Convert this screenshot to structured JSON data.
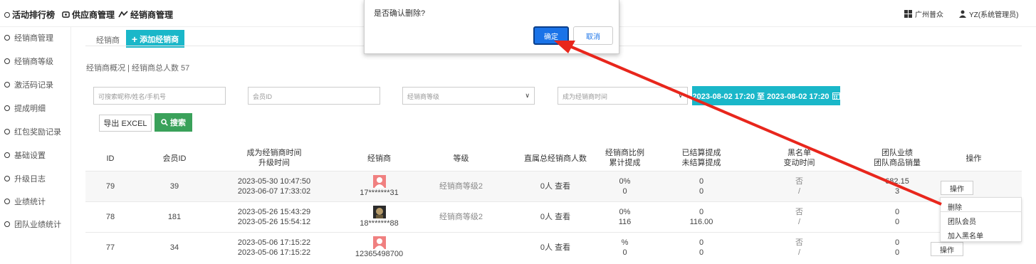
{
  "topnav": {
    "items": [
      {
        "label": "活动排行榜",
        "icon": "circle-icon"
      },
      {
        "label": "供应商管理",
        "icon": "supplier-icon"
      },
      {
        "label": "经销商管理",
        "icon": "dealer-icon"
      }
    ],
    "region": "广州普众",
    "user": "YZ(系统管理员)"
  },
  "sidebar": {
    "items": [
      {
        "label": "经销商管理"
      },
      {
        "label": "经销商等级"
      },
      {
        "label": "激活码记录"
      },
      {
        "label": "提成明细"
      },
      {
        "label": "红包奖励记录"
      },
      {
        "label": "基础设置"
      },
      {
        "label": "升级日志"
      },
      {
        "label": "业绩统计"
      },
      {
        "label": "团队业绩统计"
      }
    ]
  },
  "main": {
    "tab_label": "经销商",
    "add_button": "添加经销商",
    "summary": "经销商概况 | 经销商总人数 57",
    "filters": {
      "search_placeholder": "可搜索昵称/姓名/手机号",
      "member_id_placeholder": "会员ID",
      "level_select": "经销商等级",
      "time_select": "成为经销商时间",
      "date_range": "2023-08-02 17:20 至 2023-08-02 17:20"
    },
    "export_button": "导出 EXCEL",
    "search_button": "搜索"
  },
  "table": {
    "headers": {
      "id": "ID",
      "member_id": "会员ID",
      "time_1": "成为经销商时间",
      "time_2": "升级时间",
      "dealer": "经销商",
      "level": "等级",
      "direct": "直属总经销商人数",
      "ratio_1": "经销商比例",
      "ratio_2": "累计提成",
      "settled_1": "已结算提成",
      "settled_2": "未结算提成",
      "blacklist_1": "黑名单",
      "blacklist_2": "变动时间",
      "team_1": "团队业绩",
      "team_2": "团队商品销量",
      "op": "操作"
    },
    "rows": [
      {
        "id": "79",
        "member_id": "39",
        "time1": "2023-05-30 10:47:50",
        "time2": "2023-06-07 17:33:02",
        "dealer": "17*******31",
        "level": "经销商等级2",
        "direct_num": "0人",
        "view": "查看",
        "ratio": "0%",
        "total_commission": "0",
        "settled": "0",
        "unsettled": "0",
        "blacklist": "否",
        "change_time": "/",
        "team_perf": "682.15",
        "team_sales": "3",
        "op": "操作"
      },
      {
        "id": "78",
        "member_id": "181",
        "time1": "2023-05-26 15:43:29",
        "time2": "2023-05-26 15:54:12",
        "dealer": "18*******88",
        "level": "经销商等级2",
        "direct_num": "0人",
        "view": "查看",
        "ratio": "0%",
        "total_commission": "116",
        "settled": "0",
        "unsettled": "116.00",
        "blacklist": "否",
        "change_time": "/",
        "team_perf": "0",
        "team_sales": "0",
        "op": ""
      },
      {
        "id": "77",
        "member_id": "34",
        "time1": "2023-05-06 17:15:22",
        "time2": "2023-05-06 17:15:22",
        "dealer": "12365498700",
        "level": "",
        "direct_num": "0人",
        "view": "查看",
        "ratio": "%",
        "total_commission": "0",
        "settled": "0",
        "unsettled": "0",
        "blacklist": "否",
        "change_time": "/",
        "team_perf": "0",
        "team_sales": "0",
        "op": "操作"
      }
    ]
  },
  "dropdown": {
    "items": [
      {
        "label": "删除"
      },
      {
        "label": "团队会员"
      },
      {
        "label": "加入黑名单"
      }
    ]
  },
  "dialog": {
    "message": "是否确认删除?",
    "ok": "确定",
    "cancel": "取消"
  },
  "colors": {
    "accent": "#1ab7c9",
    "search": "#3aa15a",
    "primary": "#1a73e8",
    "arrow": "#e8261c"
  }
}
